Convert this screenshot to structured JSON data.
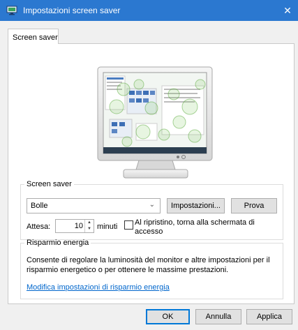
{
  "window": {
    "title": "Impostazioni screen saver",
    "close_glyph": "✕"
  },
  "tab": {
    "label": "Screen saver"
  },
  "screensaver": {
    "group_label": "Screen saver",
    "selected": "Bolle",
    "settings_label": "Impostazioni...",
    "test_label": "Prova",
    "wait_label": "Attesa:",
    "wait_value": "10",
    "minutes_label": "minuti",
    "resume_label": "Al ripristino, torna alla schermata di accesso",
    "resume_checked": false
  },
  "power": {
    "group_label": "Risparmio energia",
    "description": "Consente di regolare la luminosità del monitor e altre impostazioni per il risparmio energetico o per ottenere le massime prestazioni.",
    "link": "Modifica impostazioni di risparmio energia"
  },
  "buttons": {
    "ok": "OK",
    "cancel": "Annulla",
    "apply": "Applica"
  },
  "icons": [
    "monitor-icon",
    "close-icon",
    "chevron-down-icon",
    "spin-up-icon",
    "spin-down-icon"
  ],
  "colors": {
    "titlebar": "#2b78d0",
    "link": "#0066cc",
    "accent": "#0078d7"
  }
}
